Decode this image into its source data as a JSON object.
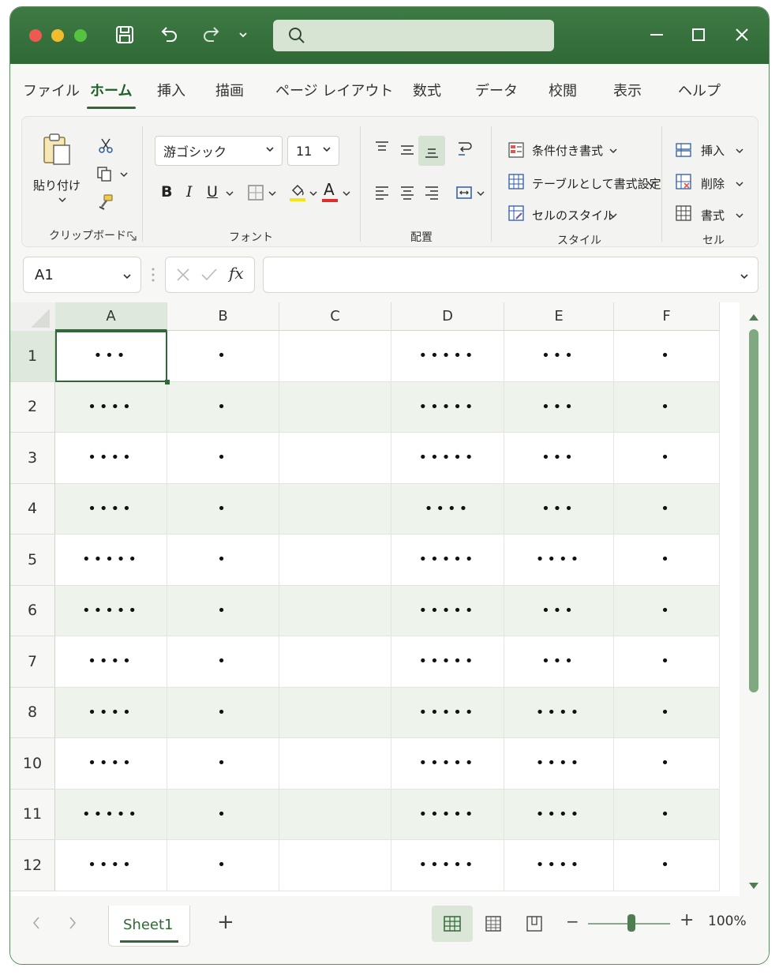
{
  "titlebar": {
    "search_placeholder": ""
  },
  "menu": {
    "tabs": [
      "ファイル",
      "ホーム",
      "挿入",
      "描画",
      "ページ レイアウト",
      "数式",
      "データ",
      "校閲",
      "表示",
      "ヘルプ"
    ],
    "active": "ホーム"
  },
  "ribbon": {
    "clipboard": {
      "paste_label": "貼り付け",
      "group_label": "クリップボード"
    },
    "font": {
      "font_name": "游ゴシック",
      "font_size": "11",
      "bold": "B",
      "italic": "I",
      "underline": "U",
      "font_color_glyph": "A",
      "group_label": "フォント"
    },
    "alignment": {
      "group_label": "配置"
    },
    "styles": {
      "conditional": "条件付き書式",
      "table": "テーブルとして書式設定",
      "cell_style": "セルのスタイル",
      "group_label": "スタイル"
    },
    "cells": {
      "insert": "挿入",
      "delete": "削除",
      "format": "書式",
      "group_label": "セル"
    }
  },
  "formula_bar": {
    "name_box": "A1",
    "fx": "fx",
    "formula": ""
  },
  "sheet": {
    "columns": [
      "A",
      "B",
      "C",
      "D",
      "E",
      "F"
    ],
    "selected_cell": "A1",
    "rows": [
      {
        "label": "1",
        "cells": [
          "•••",
          "•",
          "",
          "•••••",
          "•••",
          "•"
        ]
      },
      {
        "label": "2",
        "cells": [
          "••••",
          "•",
          "",
          "•••••",
          "•••",
          "•"
        ]
      },
      {
        "label": "3",
        "cells": [
          "••••",
          "•",
          "",
          "•••••",
          "•••",
          "•"
        ]
      },
      {
        "label": "4",
        "cells": [
          "••••",
          "•",
          "",
          "••••",
          "•••",
          "•"
        ]
      },
      {
        "label": "5",
        "cells": [
          "•••••",
          "•",
          "",
          "•••••",
          "••••",
          "•"
        ]
      },
      {
        "label": "6",
        "cells": [
          "•••••",
          "•",
          "",
          "•••••",
          "•••",
          "•"
        ]
      },
      {
        "label": "7",
        "cells": [
          "••••",
          "•",
          "",
          "•••••",
          "•••",
          "•"
        ]
      },
      {
        "label": "8",
        "cells": [
          "••••",
          "•",
          "",
          "•••••",
          "••••",
          "•"
        ]
      },
      {
        "label": "10",
        "cells": [
          "••••",
          "•",
          "",
          "•••••",
          "••••",
          "•"
        ]
      },
      {
        "label": "11",
        "cells": [
          "•••••",
          "•",
          "",
          "•••••",
          "••••",
          "•"
        ]
      },
      {
        "label": "12",
        "cells": [
          "••••",
          "•",
          "",
          "•••••",
          "••••",
          "•"
        ]
      }
    ]
  },
  "sheetbar": {
    "sheet_name": "Sheet1",
    "add_glyph": "+",
    "zoom": "100%",
    "zoom_minus": "−",
    "zoom_plus": "+"
  },
  "colors": {
    "brand_green": "#2f6a36",
    "selection_fill": "#dfe8dc",
    "band_fill": "#eef3ec"
  }
}
